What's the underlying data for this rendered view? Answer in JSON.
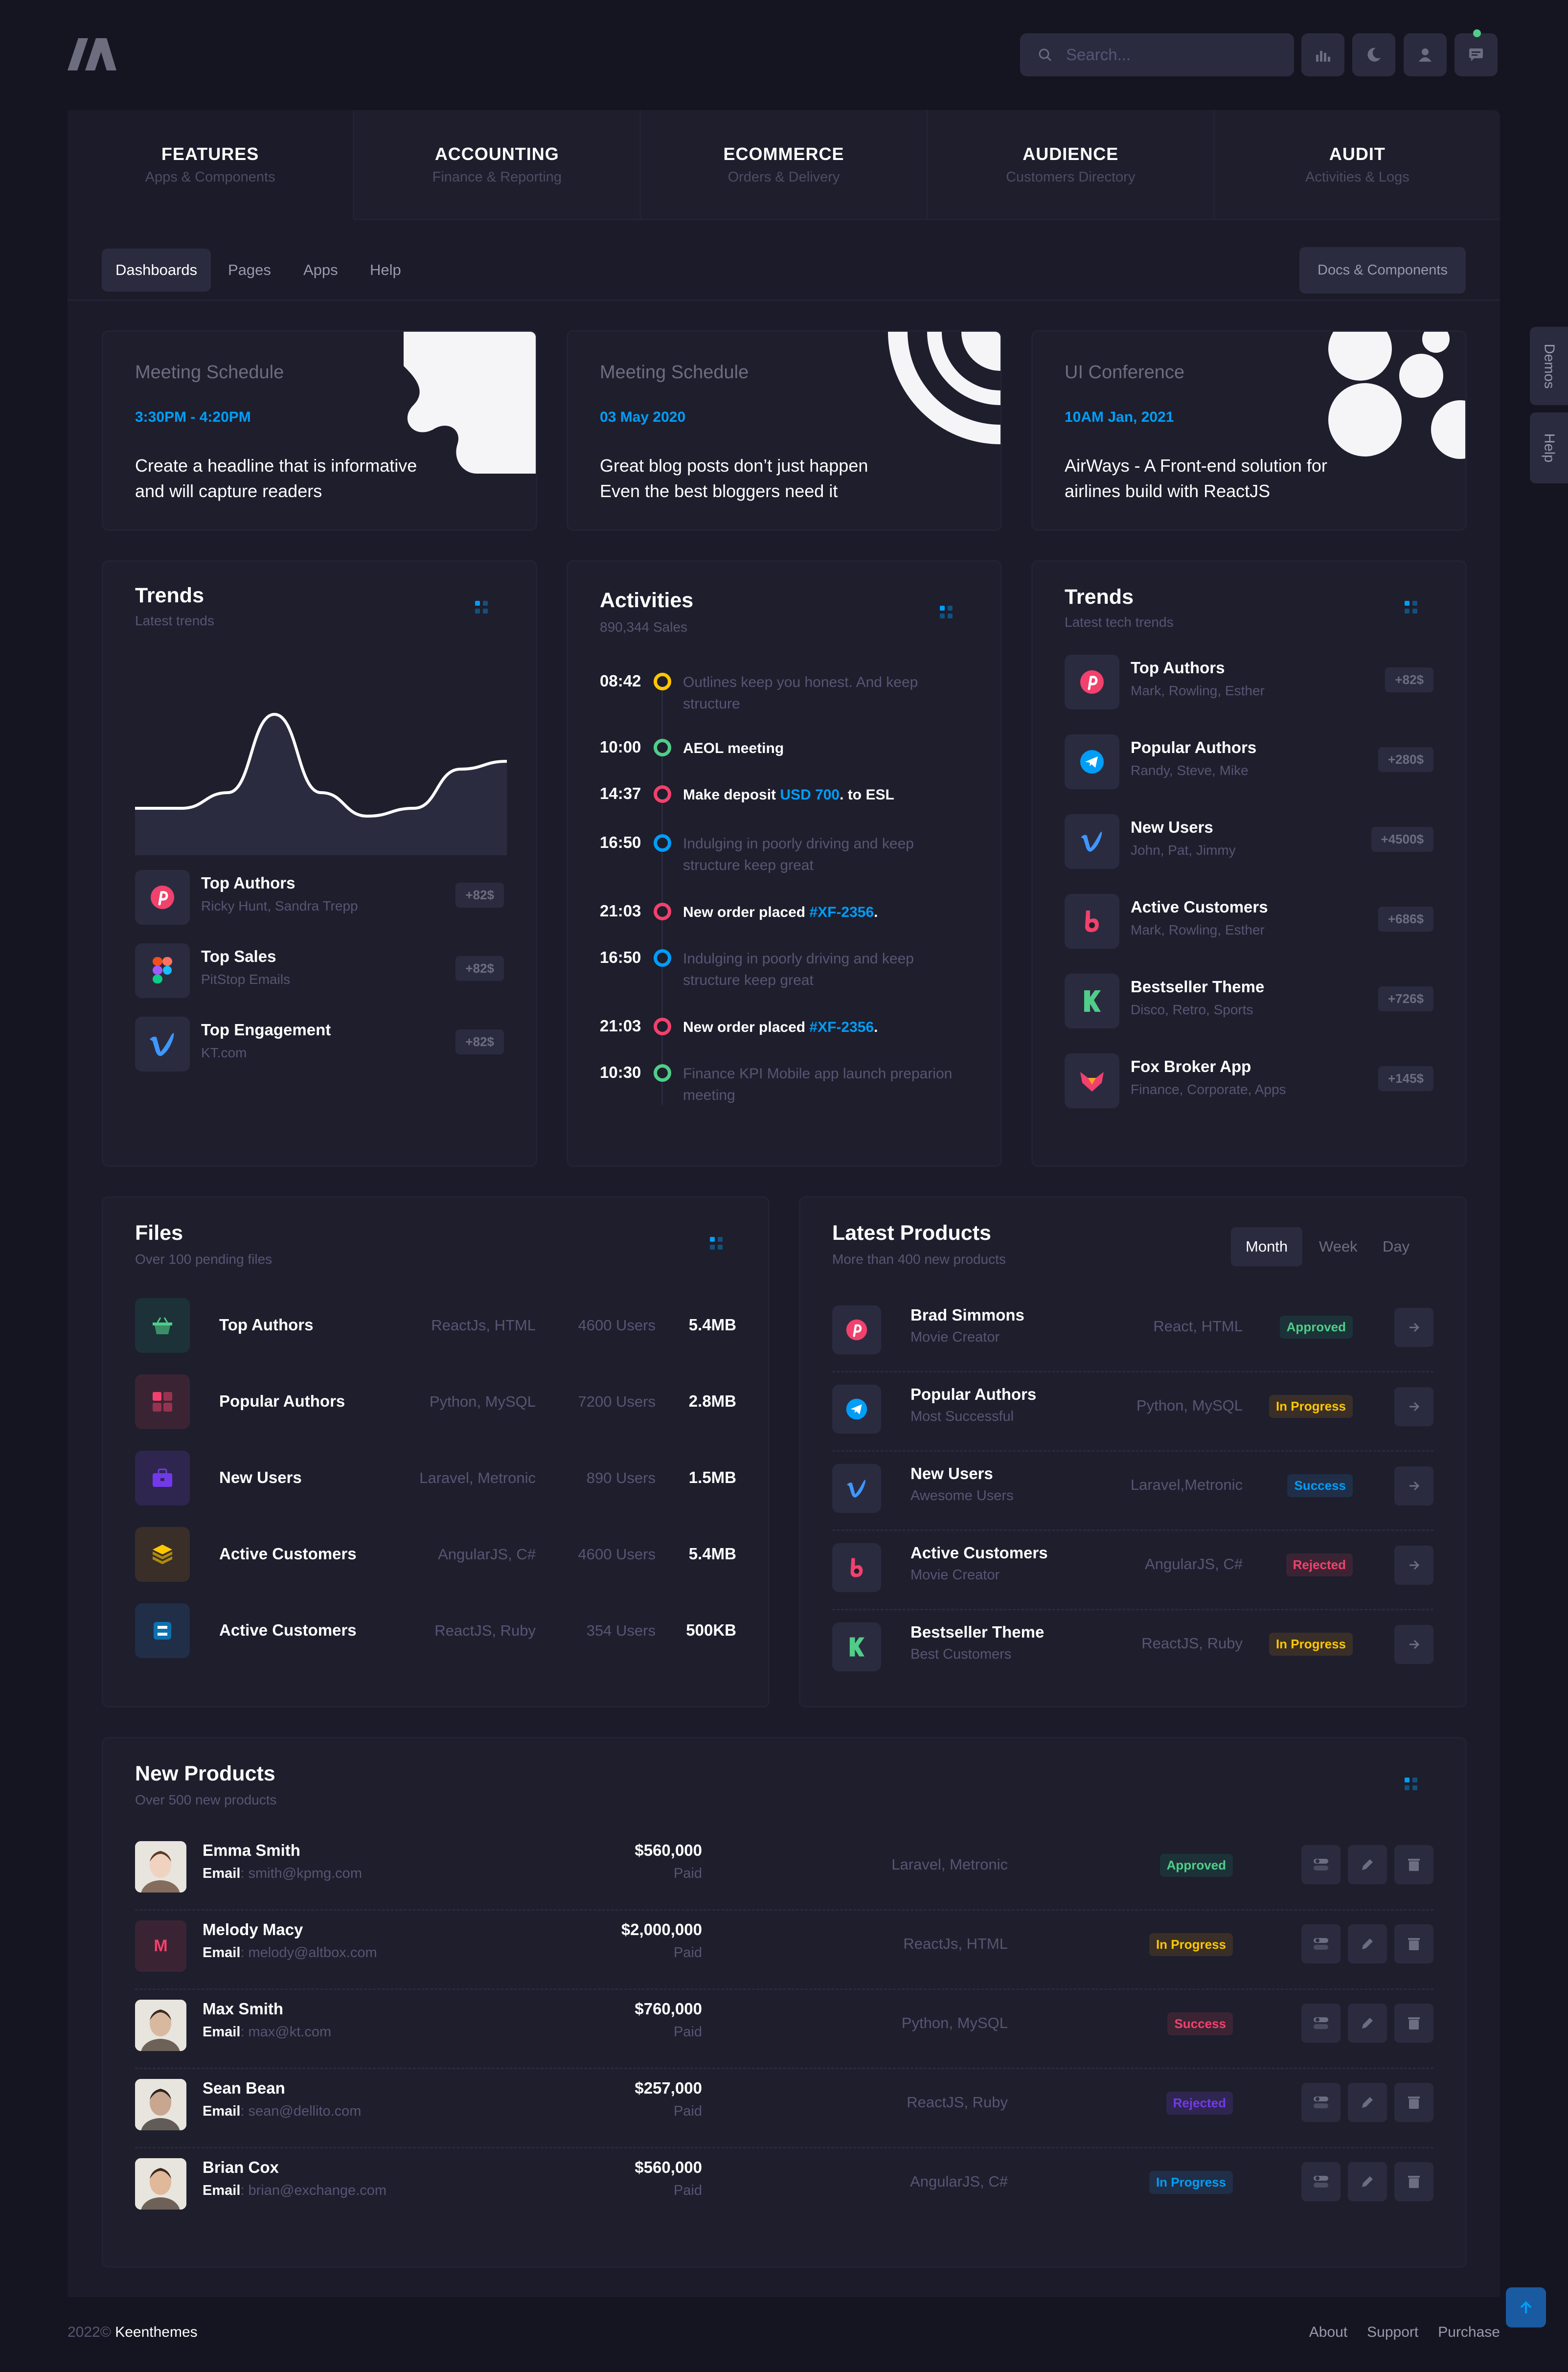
{
  "header": {
    "search_placeholder": "Search...",
    "icons": [
      "logo-icon",
      "search-icon",
      "chart-icon",
      "moon-icon",
      "user-icon",
      "chat-icon"
    ]
  },
  "nav": {
    "tabs": [
      {
        "title": "FEATURES",
        "sub": "Apps & Components"
      },
      {
        "title": "ACCOUNTING",
        "sub": "Finance & Reporting"
      },
      {
        "title": "ECOMMERCE",
        "sub": "Orders & Delivery"
      },
      {
        "title": "AUDIENCE",
        "sub": "Customers Directory"
      },
      {
        "title": "AUDIT",
        "sub": "Activities & Logs"
      }
    ],
    "subitems": [
      "Dashboards",
      "Pages",
      "Apps",
      "Help"
    ],
    "docs_button": "Docs & Components"
  },
  "promos": [
    {
      "label": "Meeting Schedule",
      "date": "3:30PM - 4:20PM",
      "text": "Create a headline that is informative and will capture readers"
    },
    {
      "label": "Meeting Schedule",
      "date": "03 May 2020",
      "text": "Great blog posts don’t just happen Even the best bloggers need it"
    },
    {
      "label": "UI Conference",
      "date": "10AM Jan, 2021",
      "text": "AirWays - A Front-end solution for airlines build with ReactJS"
    }
  ],
  "trends1": {
    "title": "Trends",
    "sub": "Latest trends",
    "chart_values": [
      0.3,
      0.3,
      0.4,
      0.9,
      0.4,
      0.25,
      0.3,
      0.55,
      0.6
    ],
    "items": [
      {
        "title": "Top Authors",
        "sub": "Ricky Hunt, Sandra Trepp",
        "badge": "+82$",
        "icon": "pinterest-icon"
      },
      {
        "title": "Top Sales",
        "sub": "PitStop Emails",
        "badge": "+82$",
        "icon": "figma-icon"
      },
      {
        "title": "Top Engagement",
        "sub": "KT.com",
        "badge": "+82$",
        "icon": "vimeo-icon"
      }
    ]
  },
  "activities": {
    "title": "Activities",
    "sub": "890,344 Sales",
    "items": [
      {
        "time": "08:42",
        "color": "#ffc700",
        "text": "Outlines keep you honest. And keep structure",
        "bold": false
      },
      {
        "time": "10:00",
        "color": "#50cd89",
        "text": "AEOL meeting",
        "bold": true
      },
      {
        "time": "14:37",
        "color": "#f1416c",
        "text": "Make deposit ",
        "link": "USD 700",
        "after": ". to ESL",
        "bold": true
      },
      {
        "time": "16:50",
        "color": "#009ef7",
        "text": "Indulging in poorly driving and keep structure keep great",
        "bold": false
      },
      {
        "time": "21:03",
        "color": "#f1416c",
        "text": "New order placed ",
        "link": "#XF-2356",
        "after": ".",
        "bold": true
      },
      {
        "time": "16:50",
        "color": "#009ef7",
        "text": "Indulging in poorly driving and keep structure keep great",
        "bold": false
      },
      {
        "time": "21:03",
        "color": "#f1416c",
        "text": "New order placed ",
        "link": "#XF-2356",
        "after": ".",
        "bold": true
      },
      {
        "time": "10:30",
        "color": "#50cd89",
        "text": "Finance KPI Mobile app launch preparion meeting",
        "bold": false
      }
    ]
  },
  "trends2": {
    "title": "Trends",
    "sub": "Latest tech trends",
    "items": [
      {
        "title": "Top Authors",
        "sub": "Mark, Rowling, Esther",
        "badge": "+82$",
        "icon": "pinterest-icon"
      },
      {
        "title": "Popular Authors",
        "sub": "Randy, Steve, Mike",
        "badge": "+280$",
        "icon": "telegram-icon"
      },
      {
        "title": "New Users",
        "sub": "John, Pat, Jimmy",
        "badge": "+4500$",
        "icon": "vimeo-icon"
      },
      {
        "title": "Active Customers",
        "sub": "Mark, Rowling, Esther",
        "badge": "+686$",
        "icon": "bebo-icon"
      },
      {
        "title": "Bestseller Theme",
        "sub": "Disco, Retro, Sports",
        "badge": "+726$",
        "icon": "kickstarter-icon"
      },
      {
        "title": "Fox Broker App",
        "sub": "Finance, Corporate, Apps",
        "badge": "+145$",
        "icon": "fox-icon"
      }
    ]
  },
  "files": {
    "title": "Files",
    "sub": "Over 100 pending files",
    "items": [
      {
        "name": "Top Authors",
        "tech": "ReactJs, HTML",
        "users": "4600 Users",
        "size": "5.4MB",
        "icon": "basket-icon",
        "bg": "#1c3238",
        "fg": "#50cd89"
      },
      {
        "name": "Popular Authors",
        "tech": "Python, MySQL",
        "users": "7200 Users",
        "size": "2.8MB",
        "icon": "grid-icon",
        "bg": "#3a2434",
        "fg": "#f1416c"
      },
      {
        "name": "New Users",
        "tech": "Laravel, Metronic",
        "users": "890 Users",
        "size": "1.5MB",
        "icon": "briefcase-icon",
        "bg": "#2f264f",
        "fg": "#7239ea"
      },
      {
        "name": "Active Customers",
        "tech": "AngularJS, C#",
        "users": "4600 Users",
        "size": "5.4MB",
        "icon": "layers-icon",
        "bg": "#392f28",
        "fg": "#ffc700"
      },
      {
        "name": "Active Customers",
        "tech": "ReactJS, Ruby",
        "users": "354 Users",
        "size": "500KB",
        "icon": "cube-icon",
        "bg": "#212e48",
        "fg": "#009ef7"
      }
    ]
  },
  "latest_products": {
    "title": "Latest Products",
    "sub": "More than 400 new products",
    "segments": [
      "Month",
      "Week",
      "Day"
    ],
    "items": [
      {
        "title": "Brad Simmons",
        "sub": "Movie Creator",
        "tech": "React, HTML",
        "status": "Approved",
        "cls": "st-approved",
        "icon": "pinterest-icon"
      },
      {
        "title": "Popular Authors",
        "sub": "Most Successful",
        "tech": "Python, MySQL",
        "status": "In Progress",
        "cls": "st-progress",
        "icon": "telegram-icon"
      },
      {
        "title": "New Users",
        "sub": "Awesome Users",
        "tech": "Laravel,Metronic",
        "status": "Success",
        "cls": "st-success",
        "icon": "vimeo-icon"
      },
      {
        "title": "Active Customers",
        "sub": "Movie Creator",
        "tech": "AngularJS, C#",
        "status": "Rejected",
        "cls": "st-rejected",
        "icon": "bebo-icon"
      },
      {
        "title": "Bestseller Theme",
        "sub": "Best Customers",
        "tech": "ReactJS, Ruby",
        "status": "In Progress",
        "cls": "st-progress",
        "icon": "kickstarter-icon"
      }
    ]
  },
  "new_products": {
    "title": "New Products",
    "sub": "Over 500 new products",
    "email_label": "Email",
    "items": [
      {
        "name": "Emma Smith",
        "email": ": smith@kpmg.com",
        "amount": "$560,000",
        "paid": "Paid",
        "tech": "Laravel, Metronic",
        "status": "Approved",
        "cls": "st-approved",
        "avatar": "photo",
        "skin": "#f0d2c0",
        "hair": "#5a3a26"
      },
      {
        "name": "Melody Macy",
        "email": ": melody@altbox.com",
        "amount": "$2,000,000",
        "paid": "Paid",
        "tech": "ReactJs, HTML",
        "status": "In Progress",
        "cls": "st-progress",
        "avatar": "M"
      },
      {
        "name": "Max Smith",
        "email": ": max@kt.com",
        "amount": "$760,000",
        "paid": "Paid",
        "tech": "Python, MySQL",
        "status": "Success",
        "cls": "st-success-red",
        "avatar": "photo",
        "skin": "#d9b8a0",
        "hair": "#3a2a20"
      },
      {
        "name": "Sean Bean",
        "email": ": sean@dellito.com",
        "amount": "$257,000",
        "paid": "Paid",
        "tech": "ReactJS, Ruby",
        "status": "Rejected",
        "cls": "st-rejected-purple",
        "avatar": "photo",
        "skin": "#c8a690",
        "hair": "#2a2220"
      },
      {
        "name": "Brian Cox",
        "email": ": brian@exchange.com",
        "amount": "$560,000",
        "paid": "Paid",
        "tech": "AngularJS, C#",
        "status": "In Progress",
        "cls": "st-success",
        "avatar": "photo",
        "skin": "#e0b89a",
        "hair": "#3a2a20"
      }
    ]
  },
  "side_tabs": [
    "Demos",
    "Help"
  ],
  "footer": {
    "year": "2022©",
    "brand": "Keenthemes",
    "links": [
      "About",
      "Support",
      "Purchase"
    ]
  }
}
